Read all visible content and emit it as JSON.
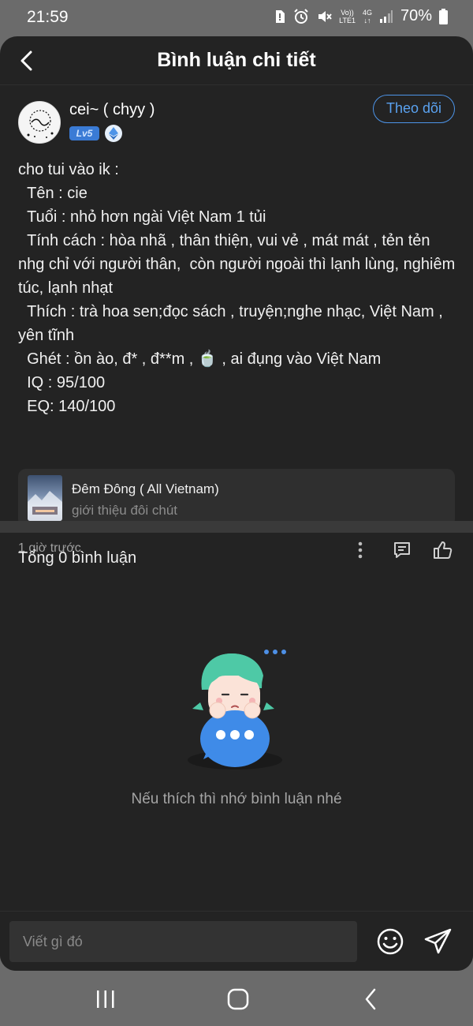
{
  "status_bar": {
    "time": "21:59",
    "network_top": "Vo))",
    "network_bottom": "LTE1",
    "network_type": "4G",
    "battery": "70%"
  },
  "header": {
    "title": "Bình luận chi tiết",
    "back_icon": "chevron-left-icon"
  },
  "post": {
    "author": {
      "name": "cei~ ( chyy )",
      "level": "Lv5",
      "badge_icon": "ethereum-diamond-icon"
    },
    "follow_label": "Theo dõi",
    "lines": [
      "cho tui vào ik :",
      "  Tên : cie",
      "  Tuổi : nhỏ hơn ngài Việt Nam 1 tủi",
      "  Tính cách : hòa nhã , thân thiện, vui vẻ , mát mát , tẻn tẻn nhg chỉ với người thân,  còn người ngoài thì lạnh lùng, nghiêm túc, lạnh nhạt",
      "  Thích : trà hoa sen;đọc sách , truyện;nghe nhạc, Việt Nam , yên tĩnh",
      "  Ghét : ồn ào, đ* , đ**m , 🍵 , ai đụng vào Việt Nam",
      "  IQ : 95/100",
      "  EQ: 140/100"
    ],
    "linked_card": {
      "title": "Đêm Đông ( All Vietnam)",
      "subtitle": "giới thiệu đôi chút"
    },
    "time": "1 giờ trước"
  },
  "comments": {
    "total_label": "Tổng 0 bình luận",
    "empty_message": "Nếu thích thì nhớ bình luận nhé"
  },
  "composer": {
    "placeholder": "Viết gì đó"
  },
  "colors": {
    "background": "#232323",
    "accent": "#4d94e8",
    "level_badge": "#3a7bd5"
  }
}
